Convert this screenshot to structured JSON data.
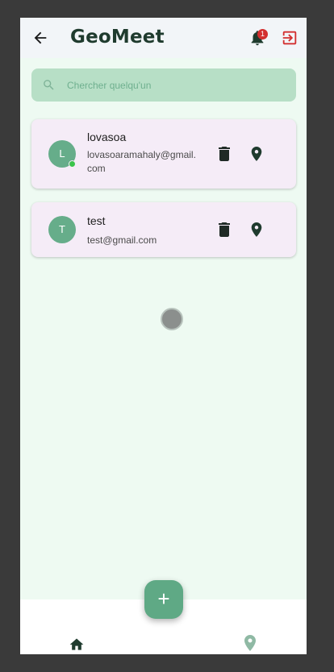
{
  "header": {
    "title": "GeoMeet",
    "notification_count": "1"
  },
  "search": {
    "placeholder": "Chercher quelqu'un"
  },
  "users": [
    {
      "initial": "L",
      "name": "lovasoa",
      "email": "lovasoaramahaly@gmail.com",
      "online": true
    },
    {
      "initial": "T",
      "name": "test",
      "email": "test@gmail.com",
      "online": false
    }
  ],
  "fab": {
    "label": "+"
  },
  "colors": {
    "accent": "#66ad8a",
    "logout": "#d32f2f",
    "online": "#3bc44b",
    "card": "#f5ecf7"
  },
  "icons": {
    "back": "arrow-left-icon",
    "notifications": "bell-icon",
    "logout": "logout-icon",
    "search": "search-icon",
    "delete": "trash-icon",
    "location": "location-pin-icon",
    "home": "home-icon",
    "map": "map-pin-icon"
  }
}
